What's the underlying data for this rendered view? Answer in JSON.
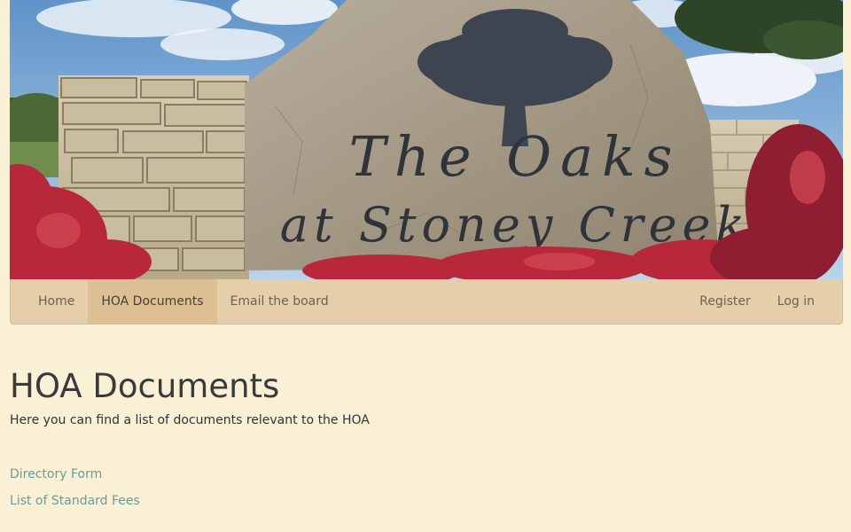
{
  "banner": {
    "sign_line1": "The Oaks",
    "sign_line2": "at Stoney Creek",
    "sky_color": "#8db6dc",
    "stone_color": "#a69c8a",
    "shrub_color": "#b8283a"
  },
  "navbar": {
    "left_items": [
      {
        "label": "Home"
      },
      {
        "label": "HOA Documents",
        "active": true
      },
      {
        "label": "Email the board"
      }
    ],
    "right_items": [
      {
        "label": "Register"
      },
      {
        "label": "Log in"
      }
    ]
  },
  "main": {
    "title": "HOA Documents",
    "description": "Here you can find a list of documents relevant to the HOA",
    "documents": [
      {
        "label": "Directory Form"
      },
      {
        "label": "List of Standard Fees"
      }
    ]
  },
  "colors": {
    "background": "#faf0d5",
    "navbar": "#e5cfaa",
    "navbar_active": "#dcbf92",
    "link": "#6a9d93"
  }
}
